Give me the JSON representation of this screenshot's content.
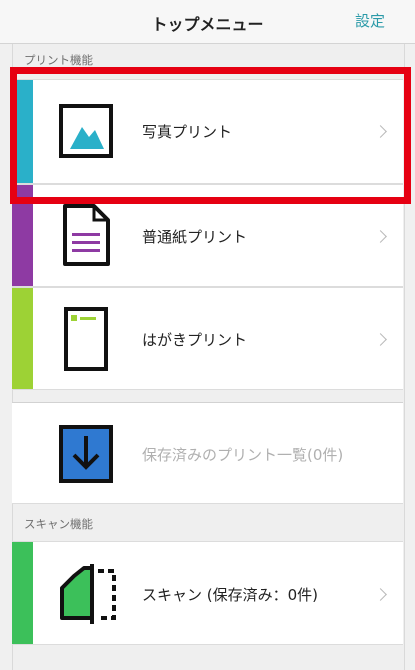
{
  "navbar": {
    "title": "トップメニュー",
    "settings_label": "設定"
  },
  "sections": {
    "print": "プリント機能",
    "scan": "スキャン機能"
  },
  "items": {
    "photo": {
      "label": "写真プリント",
      "icon": "photo-mountain-icon",
      "color": "#2ab0c9"
    },
    "document": {
      "label": "普通紙プリント",
      "icon": "document-icon",
      "color": "#8e3aa3"
    },
    "postcard": {
      "label": "はがきプリント",
      "icon": "postcard-icon",
      "color": "#9dd235"
    },
    "saved": {
      "label": "保存済みのプリント一覧(0件)",
      "icon": "download-icon",
      "color": "#2f79d1"
    },
    "scan": {
      "label": "スキャン (保存済み：0件)",
      "icon": "scan-page-icon",
      "color": "#3cc05a"
    }
  },
  "highlight_color": "#e60012"
}
